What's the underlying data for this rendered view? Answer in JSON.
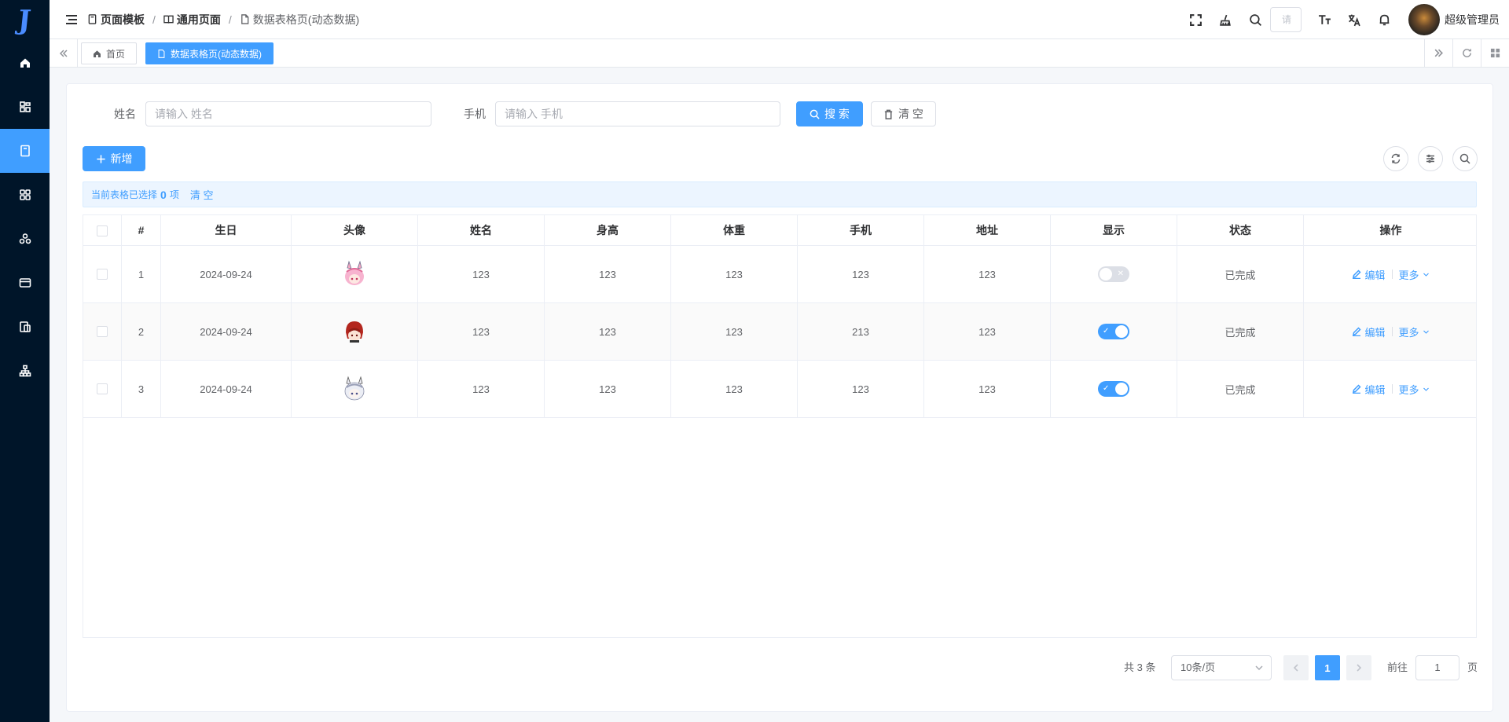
{
  "sidebar": {
    "logo": "J",
    "items": [
      {
        "icon": "home-icon"
      },
      {
        "icon": "component-icon"
      },
      {
        "icon": "page-icon",
        "active": true
      },
      {
        "icon": "grid-icon"
      },
      {
        "icon": "apps-icon"
      },
      {
        "icon": "card-icon"
      },
      {
        "icon": "document-icon"
      },
      {
        "icon": "org-chart-icon"
      }
    ]
  },
  "header": {
    "breadcrumb": [
      "页面模板",
      "通用页面",
      "数据表格页(动态数据)"
    ],
    "search_placeholder": "请",
    "username": "超级管理员"
  },
  "tabs": [
    {
      "label": "首页",
      "icon": "home-icon"
    },
    {
      "label": "数据表格页(动态数据)",
      "icon": "page-icon",
      "active": true
    }
  ],
  "search": {
    "name_label": "姓名",
    "name_placeholder": "请输入 姓名",
    "phone_label": "手机",
    "phone_placeholder": "请输入 手机",
    "search_button": "搜 索",
    "clear_button": "清 空"
  },
  "toolbar": {
    "add_button": "新增"
  },
  "selection": {
    "prefix": "当前表格已选择",
    "count": "0",
    "suffix": "项",
    "clear": "清 空"
  },
  "table": {
    "columns": [
      "#",
      "生日",
      "头像",
      "姓名",
      "身高",
      "体重",
      "手机",
      "地址",
      "显示",
      "状态",
      "操作"
    ],
    "rows": [
      {
        "index": "1",
        "birthday": "2024-09-24",
        "avatar": "pink-character",
        "name": "123",
        "height": "123",
        "weight": "123",
        "phone": "123",
        "address": "123",
        "show": false,
        "status": "已完成"
      },
      {
        "index": "2",
        "birthday": "2024-09-24",
        "avatar": "red-character",
        "name": "123",
        "height": "123",
        "weight": "123",
        "phone": "213",
        "address": "123",
        "show": true,
        "status": "已完成"
      },
      {
        "index": "3",
        "birthday": "2024-09-24",
        "avatar": "white-character",
        "name": "123",
        "height": "123",
        "weight": "123",
        "phone": "123",
        "address": "123",
        "show": true,
        "status": "已完成"
      }
    ],
    "edit_label": "编辑",
    "more_label": "更多"
  },
  "pagination": {
    "total": "共 3 条",
    "page_size": "10条/页",
    "current": "1",
    "goto_label": "前往",
    "goto_value": "1",
    "page_label": "页"
  },
  "colors": {
    "primary": "#409eff",
    "sidebar": "#001529"
  }
}
